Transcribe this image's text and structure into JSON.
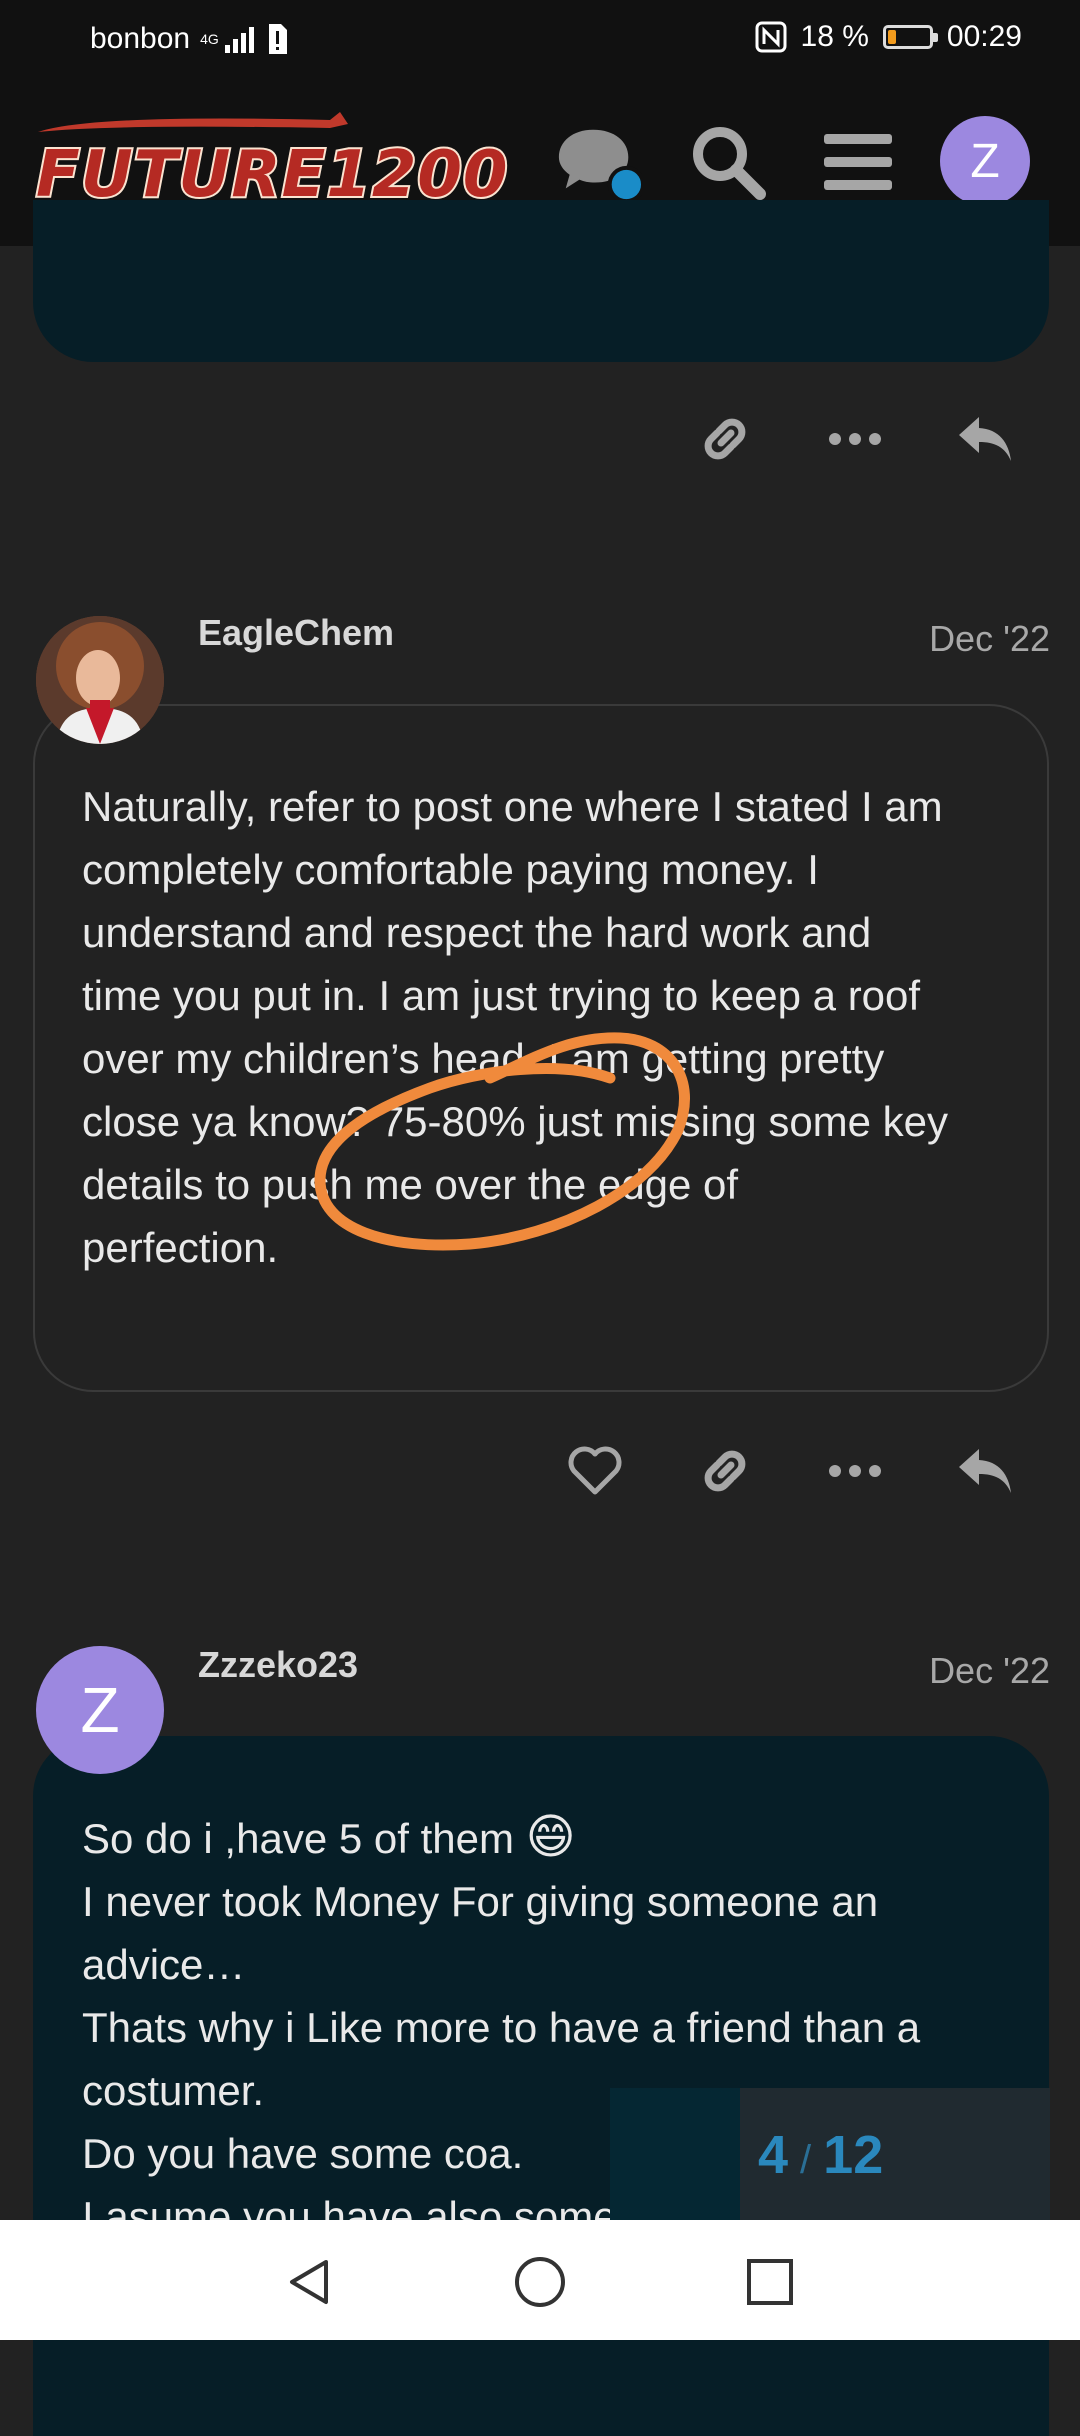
{
  "status_bar": {
    "carrier": "bonbon",
    "network": "4G",
    "battery_percent": "18 %",
    "battery_level": 0.18,
    "time": "00:29",
    "accent": "#f29b1d"
  },
  "header": {
    "logo_text": "FUTURE1200",
    "icons": [
      "chat-icon",
      "search-icon",
      "menu-icon"
    ],
    "user_avatar_letter": "Z",
    "avatar_color": "#9c88e0",
    "unread_dot_color": "#1a8cc8"
  },
  "posts": [
    {
      "username": "EagleChem",
      "date": "Dec '22",
      "lines": [
        "Naturally, refer to post one where I stated I am",
        "completely comfortable paying money. I",
        "understand and respect the hard work and",
        "time you put in. I am just trying to keep a roof",
        "over my children’s head. I am getting pretty",
        "close ya know? 75-80% just missing some key",
        "details to push me over the edge of",
        "perfection."
      ],
      "annotation_color": "#f08a3c"
    },
    {
      "username": "Zzzeko23",
      "avatar_letter": "Z",
      "date": "Dec '22",
      "lines": [
        "So do i ,have 5 of them",
        "I never took Money For giving someone an",
        "advice…",
        "Thats why i Like more to have a friend than a",
        "costumer.",
        "Do you have some coa.",
        "I asume you have also some"
      ],
      "emoji": "😄"
    }
  ],
  "progress": {
    "current": "4",
    "separator": "/",
    "total": "12",
    "color": "#2a88bd"
  },
  "navbar": {
    "buttons": [
      "back-icon",
      "home-icon",
      "recents-icon"
    ]
  }
}
